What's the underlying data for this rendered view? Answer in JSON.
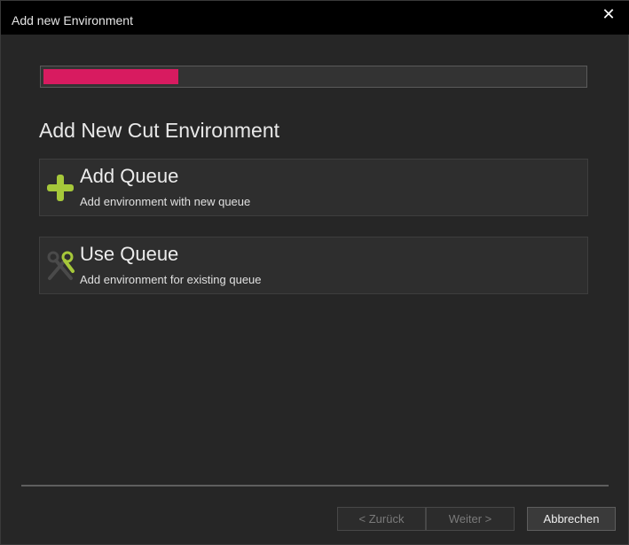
{
  "window": {
    "title": "Add new Environment",
    "close_glyph": "✕"
  },
  "progress": {
    "fraction": 0.25,
    "color": "#d81b60"
  },
  "main": {
    "heading": "Add New Cut Environment",
    "options": [
      {
        "icon": "plus-icon",
        "title": "Add Queue",
        "description": "Add environment with new queue"
      },
      {
        "icon": "scissors-icon",
        "title": "Use Queue",
        "description": "Add environment for existing queue"
      }
    ]
  },
  "footer": {
    "back_label": "< Zurück",
    "next_label": "Weiter >",
    "cancel_label": "Abbrechen"
  },
  "colors": {
    "accent_green": "#a6c83a",
    "background": "#262626",
    "titlebar": "#000000"
  }
}
